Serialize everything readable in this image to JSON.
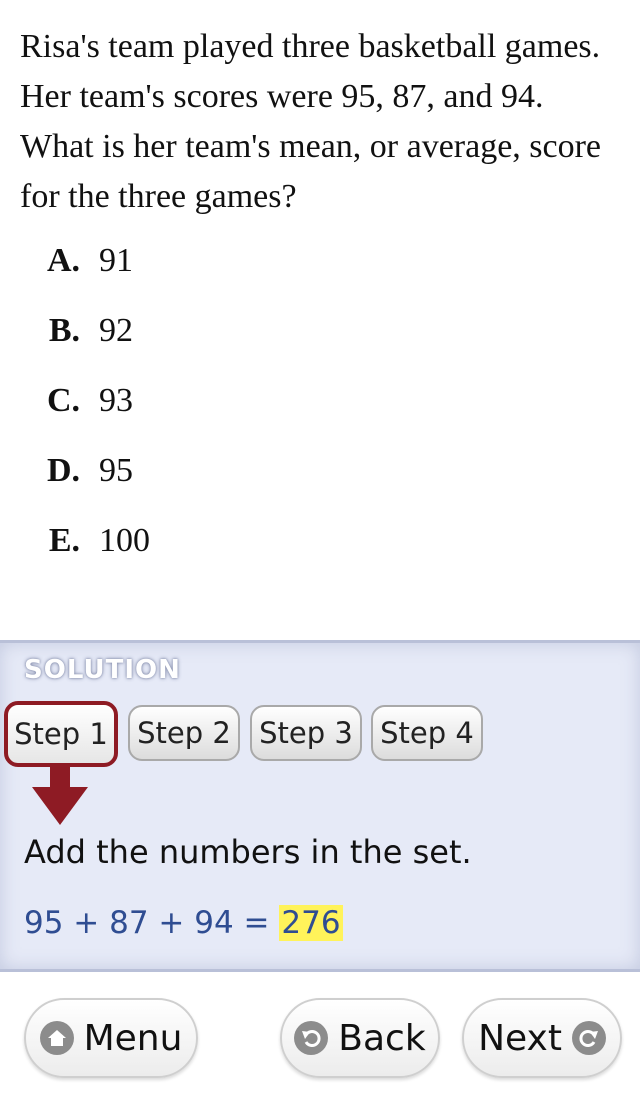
{
  "question": {
    "text": "Risa's team played three basketball games. Her team's scores were 95, 87, and 94. What is her team's mean, or average, score for the three games?"
  },
  "choices": [
    {
      "letter": "A.",
      "value": "91"
    },
    {
      "letter": "B.",
      "value": "92"
    },
    {
      "letter": "C.",
      "value": "93"
    },
    {
      "letter": "D.",
      "value": "95"
    },
    {
      "letter": "E.",
      "value": "100"
    }
  ],
  "solution": {
    "label": "SOLUTION",
    "steps": [
      "Step 1",
      "Step 2",
      "Step 3",
      "Step 4"
    ],
    "active_step": "Step 1",
    "instruction": "Add the numbers in the set.",
    "equation_lhs": "95 + 87 + 94 = ",
    "equation_result": "276"
  },
  "nav": {
    "menu_label": "Menu",
    "back_label": "Back",
    "next_label": "Next"
  },
  "colors": {
    "active_step_border": "#8e1b24",
    "equation_text": "#2f4d92",
    "highlight": "#fff35a",
    "solution_bg": "#e6eaf7"
  }
}
